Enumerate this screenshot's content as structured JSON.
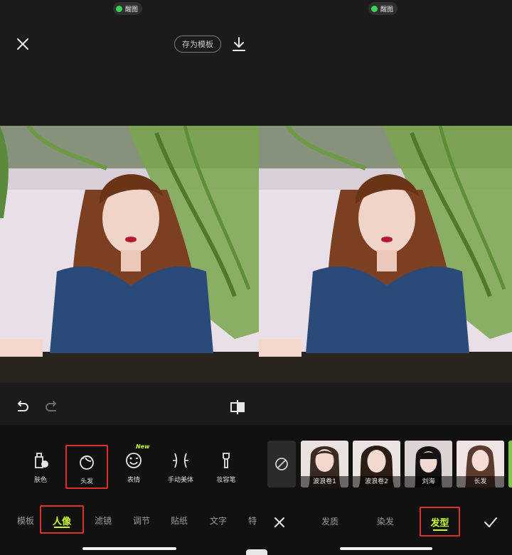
{
  "status_pill": {
    "label": "醒图"
  },
  "left_header": {
    "save_template_label": "存为模板"
  },
  "left_tools": [
    {
      "label": "肤色"
    },
    {
      "label": "头发"
    },
    {
      "label": "表情",
      "badge": "New"
    },
    {
      "label": "手动美体"
    },
    {
      "label": "妆容笔"
    }
  ],
  "left_categories": {
    "items": [
      "模板",
      "人像",
      "滤镜",
      "调节",
      "贴纸",
      "文字",
      "特"
    ],
    "selected": "人像"
  },
  "hair_styles": [
    {
      "label": "波浪卷1"
    },
    {
      "label": "波浪卷2"
    },
    {
      "label": "刘海"
    },
    {
      "label": "长发"
    }
  ],
  "right_tabs": {
    "items": [
      "发质",
      "染发",
      "发型"
    ],
    "selected": "发型"
  },
  "colors": {
    "accent": "#c6ff2e",
    "highlight_box": "#e0302b",
    "background": "#1b1b1b"
  }
}
